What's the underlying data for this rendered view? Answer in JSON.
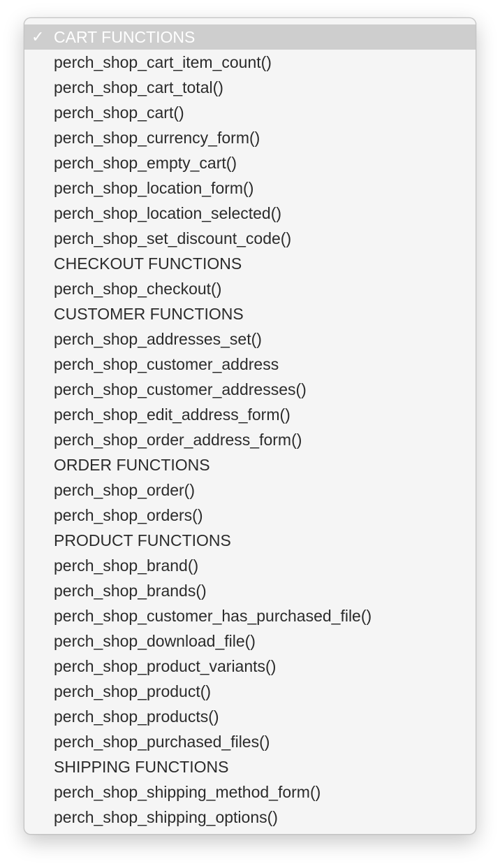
{
  "menu": {
    "selected_index": 0,
    "items": [
      {
        "label": "CART FUNCTIONS",
        "type": "header",
        "checked": true
      },
      {
        "label": "perch_shop_cart_item_count()",
        "type": "item"
      },
      {
        "label": "perch_shop_cart_total()",
        "type": "item"
      },
      {
        "label": "perch_shop_cart()",
        "type": "item"
      },
      {
        "label": "perch_shop_currency_form()",
        "type": "item"
      },
      {
        "label": "perch_shop_empty_cart()",
        "type": "item"
      },
      {
        "label": "perch_shop_location_form()",
        "type": "item"
      },
      {
        "label": "perch_shop_location_selected()",
        "type": "item"
      },
      {
        "label": "perch_shop_set_discount_code()",
        "type": "item"
      },
      {
        "label": "CHECKOUT FUNCTIONS",
        "type": "header"
      },
      {
        "label": "perch_shop_checkout()",
        "type": "item"
      },
      {
        "label": "CUSTOMER FUNCTIONS",
        "type": "header"
      },
      {
        "label": "perch_shop_addresses_set()",
        "type": "item"
      },
      {
        "label": "perch_shop_customer_address",
        "type": "item"
      },
      {
        "label": "perch_shop_customer_addresses()",
        "type": "item"
      },
      {
        "label": "perch_shop_edit_address_form()",
        "type": "item"
      },
      {
        "label": "perch_shop_order_address_form()",
        "type": "item"
      },
      {
        "label": "ORDER FUNCTIONS",
        "type": "header"
      },
      {
        "label": "perch_shop_order()",
        "type": "item"
      },
      {
        "label": "perch_shop_orders()",
        "type": "item"
      },
      {
        "label": "PRODUCT FUNCTIONS",
        "type": "header"
      },
      {
        "label": "perch_shop_brand()",
        "type": "item"
      },
      {
        "label": "perch_shop_brands()",
        "type": "item"
      },
      {
        "label": "perch_shop_customer_has_purchased_file()",
        "type": "item"
      },
      {
        "label": "perch_shop_download_file()",
        "type": "item"
      },
      {
        "label": "perch_shop_product_variants()",
        "type": "item"
      },
      {
        "label": "perch_shop_product()",
        "type": "item"
      },
      {
        "label": "perch_shop_products()",
        "type": "item"
      },
      {
        "label": "perch_shop_purchased_files()",
        "type": "item"
      },
      {
        "label": "SHIPPING FUNCTIONS",
        "type": "header"
      },
      {
        "label": "perch_shop_shipping_method_form()",
        "type": "item"
      },
      {
        "label": "perch_shop_shipping_options()",
        "type": "item"
      }
    ],
    "check_icon": "✓",
    "colors": {
      "selected_bg": "#cecece",
      "menu_bg": "#f5f5f5",
      "text": "#2b2b2b"
    }
  }
}
